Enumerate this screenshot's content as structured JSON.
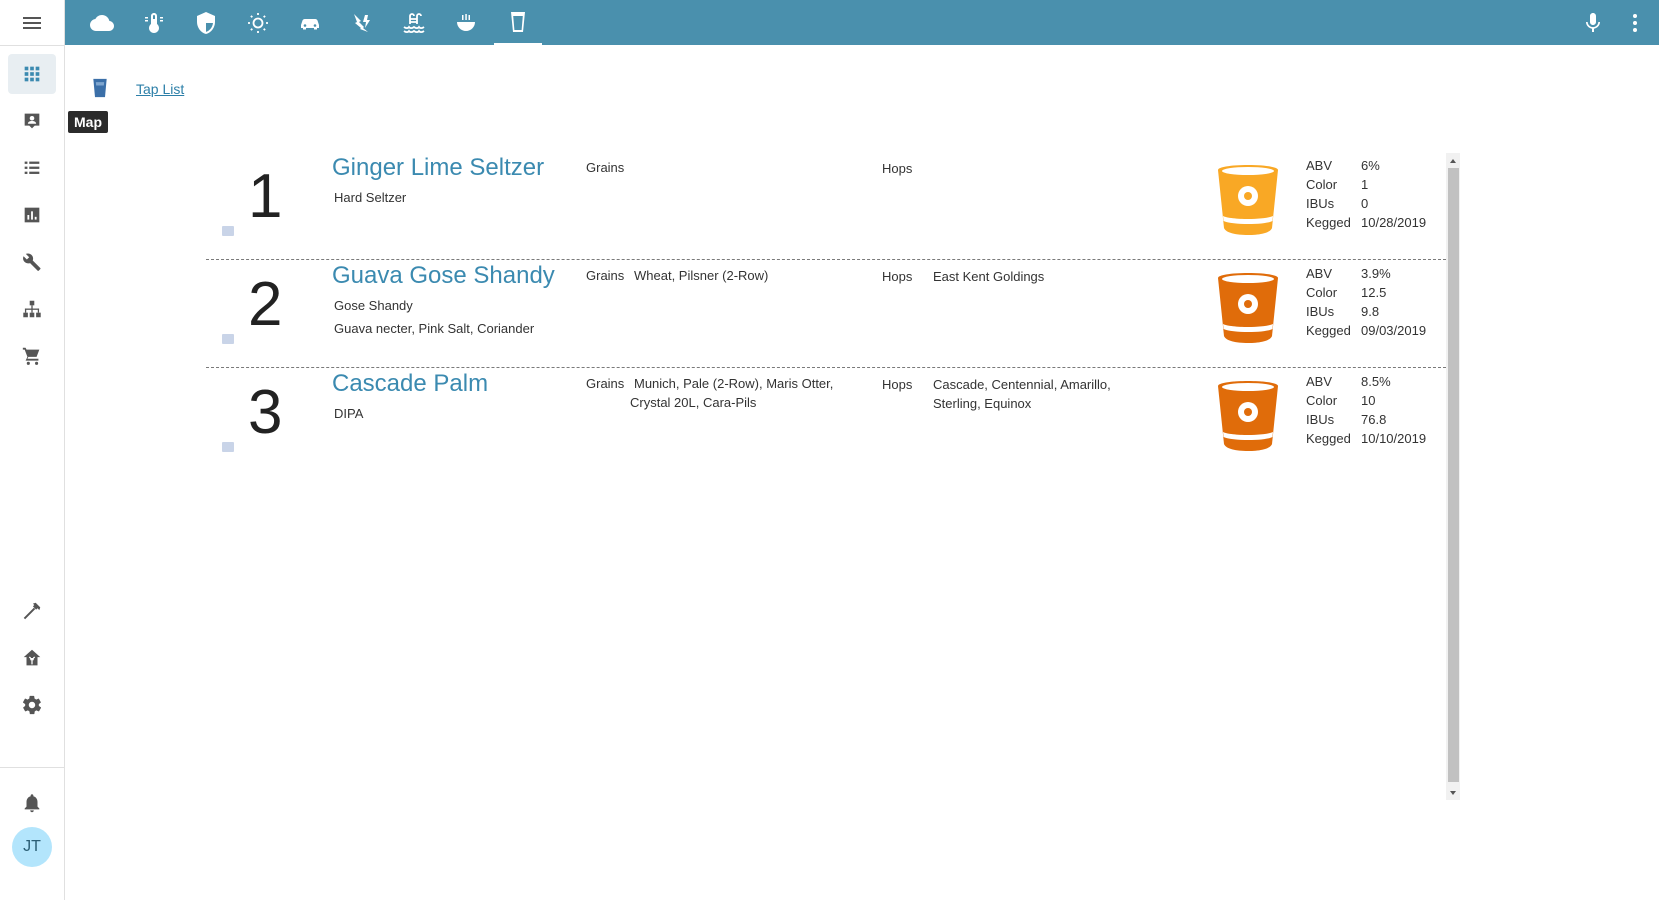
{
  "sidebar": {
    "avatar_initials": "JT",
    "tooltip": "Map",
    "top_items": [
      "grid-icon",
      "badge-icon",
      "list-icon",
      "chart-icon",
      "wrench-icon",
      "hierarchy-icon",
      "cart-icon"
    ],
    "bottom_items": [
      "hammer-icon",
      "home-assistant-icon",
      "gear-icon"
    ]
  },
  "topbar": {
    "tabs": [
      "cloud-icon",
      "thermometer-icon",
      "shield-icon",
      "lightbulb-icon",
      "car-icon",
      "flash-icon",
      "pool-icon",
      "bowl-icon",
      "glass-icon"
    ],
    "active_tab": "glass-icon",
    "accent": "#4a90ad"
  },
  "page": {
    "link": "Tap List"
  },
  "taps": [
    {
      "number": "1",
      "name": "Ginger Lime Seltzer",
      "style": "Hard Seltzer",
      "extra": "",
      "grains_label": "Grains",
      "grains": "",
      "hops_label": "Hops",
      "hops": "",
      "glass_color": "#f9a825",
      "abv_label": "ABV",
      "abv": "6%",
      "color_label": "Color",
      "color": "1",
      "ibus_label": "IBUs",
      "ibus": "0",
      "kegged_label": "Kegged",
      "kegged": "10/28/2019"
    },
    {
      "number": "2",
      "name": "Guava Gose Shandy",
      "style": "Gose Shandy",
      "extra": "Guava necter, Pink Salt, Coriander",
      "grains_label": "Grains",
      "grains": "Wheat, Pilsner (2-Row)",
      "hops_label": "Hops",
      "hops": "East Kent Goldings",
      "glass_color": "#e06c0a",
      "abv_label": "ABV",
      "abv": "3.9%",
      "color_label": "Color",
      "color": "12.5",
      "ibus_label": "IBUs",
      "ibus": "9.8",
      "kegged_label": "Kegged",
      "kegged": "09/03/2019"
    },
    {
      "number": "3",
      "name": "Cascade Palm",
      "style": "DIPA",
      "extra": "",
      "grains_label": "Grains",
      "grains": "Munich, Pale (2-Row), Maris Otter, Crystal 20L, Cara-Pils",
      "hops_label": "Hops",
      "hops": "Cascade, Centennial, Amarillo, Sterling, Equinox",
      "glass_color": "#e06c0a",
      "abv_label": "ABV",
      "abv": "8.5%",
      "color_label": "Color",
      "color": "10",
      "ibus_label": "IBUs",
      "ibus": "76.8",
      "kegged_label": "Kegged",
      "kegged": "10/10/2019"
    }
  ]
}
